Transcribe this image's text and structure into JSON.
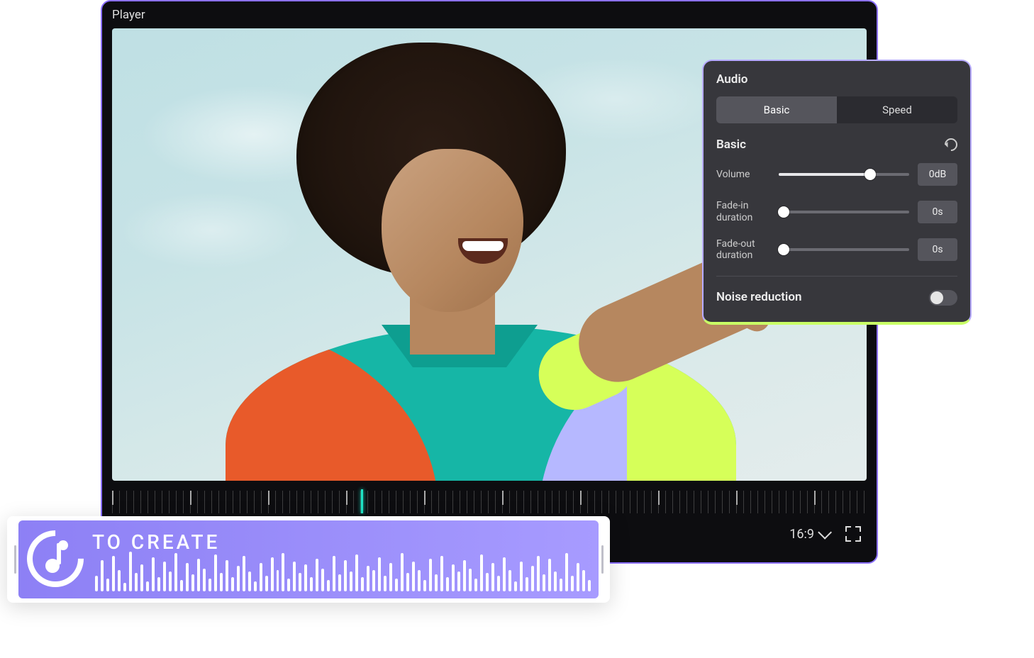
{
  "player": {
    "title": "Player",
    "aspect_ratio": "16:9"
  },
  "audio_panel": {
    "title": "Audio",
    "tabs": {
      "basic": "Basic",
      "speed": "Speed",
      "active": "basic"
    },
    "section_label": "Basic",
    "controls": {
      "volume": {
        "label": "Volume",
        "value": "0dB",
        "percent": 70
      },
      "fade_in": {
        "label": "Fade-in duration",
        "value": "0s",
        "percent": 0
      },
      "fade_out": {
        "label": "Fade-out duration",
        "value": "0s",
        "percent": 0
      }
    },
    "noise_reduction": {
      "label": "Noise reduction",
      "on": false
    }
  },
  "clip": {
    "title": "TO CREATE",
    "waveform": [
      22,
      44,
      18,
      50,
      30,
      12,
      56,
      26,
      38,
      14,
      48,
      20,
      42,
      28,
      54,
      16,
      40,
      24,
      46,
      32,
      18,
      52,
      26,
      44,
      20,
      36,
      50,
      28,
      14,
      40,
      22,
      48,
      30,
      54,
      18,
      42,
      26,
      38,
      20,
      46,
      32,
      16,
      50,
      24,
      44,
      28,
      52,
      20,
      36,
      30,
      48,
      22,
      40,
      18,
      54,
      26,
      42,
      30,
      16,
      46,
      24,
      50,
      20,
      38,
      28,
      44,
      32,
      18,
      52,
      26,
      40,
      22,
      48,
      30,
      14,
      42,
      20,
      36,
      50,
      24,
      46,
      28,
      18,
      54,
      22,
      40,
      30,
      16
    ]
  }
}
